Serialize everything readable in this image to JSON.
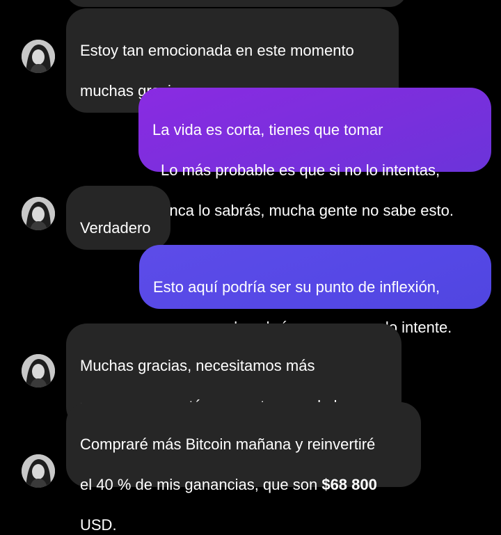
{
  "conversation": {
    "messages": [
      {
        "side": "received",
        "lines": [
          "Estoy tan emocionada en este momento",
          "muchas gracias"
        ]
      },
      {
        "side": "sent",
        "lines": [
          "La vida es corta, tienes que tomar",
          "Lo más probable es que si no lo intentas,",
          "nunca lo sabrás, mucha gente no sabe esto."
        ]
      },
      {
        "side": "received",
        "lines": [
          "Verdadero"
        ]
      },
      {
        "side": "sent",
        "lines": [
          "Esto aquí podría ser su punto de inflexión,",
          "pero nunca lo sabrá a menos que lo intente."
        ]
      },
      {
        "side": "received",
        "lines": [
          "Muchas gracias, necesitamos más",
          "personas como tú en nuestro mundo hoy."
        ]
      },
      {
        "side": "received",
        "lines": [
          "Compraré más Bitcoin mañana y reinvertiré",
          "el 40 % de mis ganancias, que son "
        ],
        "amount": "$68 800",
        "suffix": "USD."
      }
    ]
  },
  "colors": {
    "background": "#000000",
    "received_bubble": "#262626",
    "sent_bubble_purple": "#7f2fdf",
    "sent_bubble_indigo": "#5a4ae6",
    "text": "#ffffff"
  },
  "icons": {
    "avatar": "contact-avatar-photo"
  }
}
